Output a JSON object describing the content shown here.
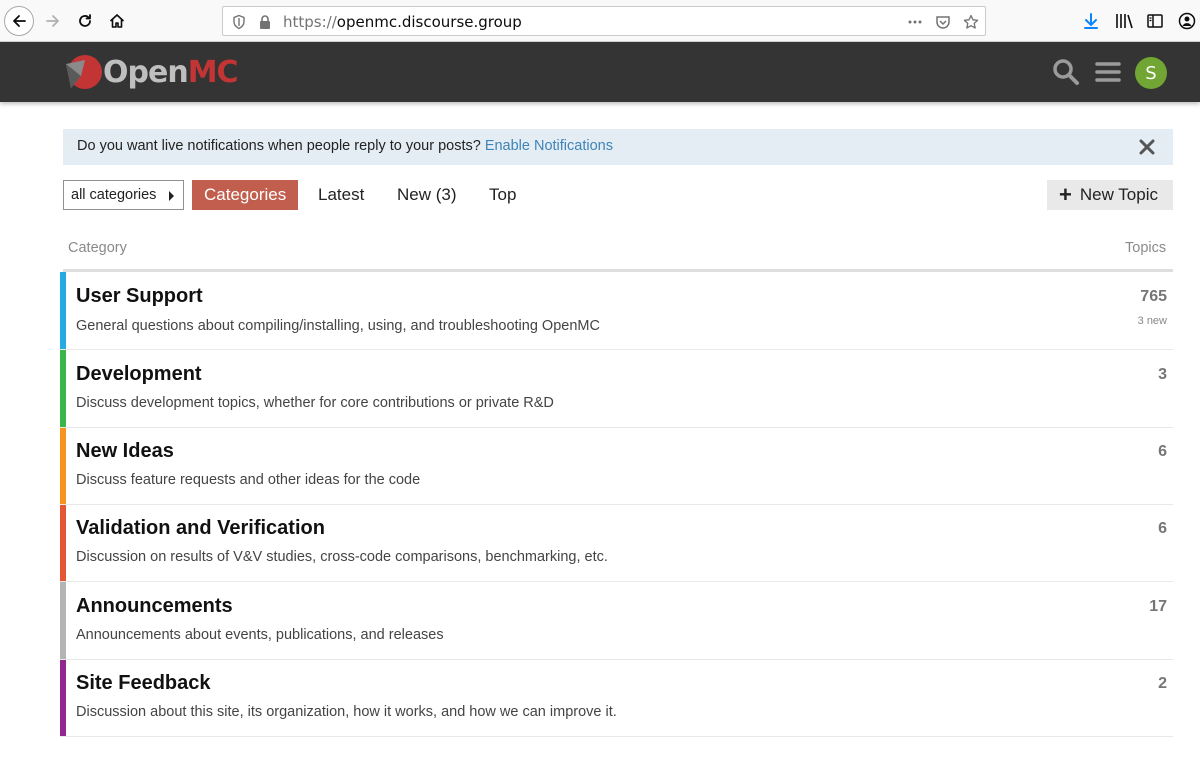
{
  "browser": {
    "url_protocol": "https://",
    "url_host": "openmc.discourse.group"
  },
  "header": {
    "logo_open": "Open",
    "logo_mc": "MC",
    "avatar_letter": "S",
    "avatar_color": "#71a534"
  },
  "notification": {
    "text": "Do you want live notifications when people reply to your posts?",
    "link": "Enable Notifications"
  },
  "nav": {
    "category_select": "all categories",
    "tabs": [
      {
        "label": "Categories",
        "active": true
      },
      {
        "label": "Latest"
      },
      {
        "label": "New (3)"
      },
      {
        "label": "Top"
      }
    ],
    "new_topic": "New Topic"
  },
  "table": {
    "col_category": "Category",
    "col_topics": "Topics",
    "rows": [
      {
        "name": "User Support",
        "description": "General questions about compiling/installing, using, and troubleshooting OpenMC",
        "topics": "765",
        "new": "3 new",
        "color": "#25aae2"
      },
      {
        "name": "Development",
        "description": "Discuss development topics, whether for core contributions or private R&D",
        "topics": "3",
        "color": "#3ab54a"
      },
      {
        "name": "New Ideas",
        "description": "Discuss feature requests and other ideas for the code",
        "topics": "6",
        "color": "#f7941d"
      },
      {
        "name": "Validation and Verification",
        "description": "Discussion on results of V&V studies, cross-code comparisons, benchmarking, etc.",
        "topics": "6",
        "color": "#e45735"
      },
      {
        "name": "Announcements",
        "description": "Announcements about events, publications, and releases",
        "topics": "17",
        "color": "#b3b5b4"
      },
      {
        "name": "Site Feedback",
        "description": "Discussion about this site, its organization, how it works, and how we can improve it.",
        "topics": "2",
        "color": "#92278f"
      }
    ]
  }
}
